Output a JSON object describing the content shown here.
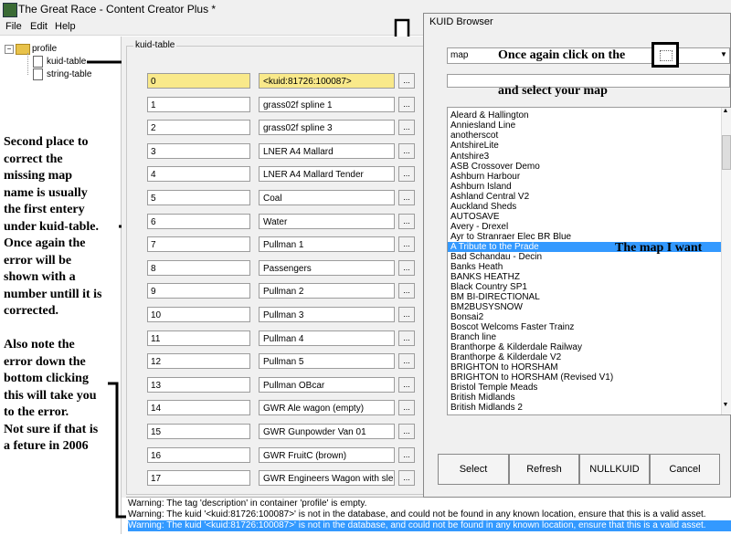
{
  "window": {
    "title": "The Great Race - Content Creator Plus *"
  },
  "menu": [
    "File",
    "Edit",
    "Help"
  ],
  "tree": {
    "root": "profile",
    "children": [
      "kuid-table",
      "string-table"
    ]
  },
  "group_label": "kuid-table",
  "rows": [
    {
      "index": "0",
      "value": "<kuid:81726:100087>"
    },
    {
      "index": "1",
      "value": "grass02f spline 1"
    },
    {
      "index": "2",
      "value": "grass02f spline 3"
    },
    {
      "index": "3",
      "value": "LNER A4 Mallard"
    },
    {
      "index": "4",
      "value": "LNER A4 Mallard Tender"
    },
    {
      "index": "5",
      "value": "Coal"
    },
    {
      "index": "6",
      "value": "Water"
    },
    {
      "index": "7",
      "value": "Pullman 1"
    },
    {
      "index": "8",
      "value": "Passengers"
    },
    {
      "index": "9",
      "value": "Pullman 2"
    },
    {
      "index": "10",
      "value": "Pullman 3"
    },
    {
      "index": "11",
      "value": "Pullman 4"
    },
    {
      "index": "12",
      "value": "Pullman 5"
    },
    {
      "index": "13",
      "value": "Pullman OBcar"
    },
    {
      "index": "14",
      "value": "GWR Ale wagon (empty)"
    },
    {
      "index": "15",
      "value": "GWR Gunpowder Van 01"
    },
    {
      "index": "16",
      "value": "GWR FruitC (brown)"
    },
    {
      "index": "17",
      "value": "GWR Engineers Wagon with sleepe"
    }
  ],
  "dots_label": "...",
  "status_lines": [
    "Warning: The tag 'description' in container 'profile' is empty.",
    "Warning: The kuid '<kuid:81726:100087>' is not in the database, and could not be found in any known location, ensure that this is a valid asset.",
    "Warning: The kuid '<kuid:81726:100087>' is not in the database, and could not be found in any known location, ensure that this is a valid asset."
  ],
  "annotation_left": [
    "Second place to",
    "correct the",
    "missing map",
    "name is usually",
    "the first entery",
    "under kuid-table.",
    "Once again the",
    "error will be",
    "shown with a",
    "number untill it is",
    "corrected.",
    "",
    "Also note the",
    "error down the",
    "bottom clicking",
    "this will take you",
    "to the error.",
    "Not sure if that is",
    "a feture in 2006"
  ],
  "kuid_browser": {
    "title": "KUID Browser",
    "filter_value": "map",
    "annotation_top": "Once again click on the",
    "annotation_select": "and select your map",
    "annotation_map": "The map I want",
    "items": [
      "Aleard & Hallington",
      "Anniesland Line",
      "anotherscot",
      "AntshireLite",
      "Antshire3",
      "ASB Crossover Demo",
      "Ashburn Harbour",
      "Ashburn Island",
      "Ashland Central V2",
      "Auckland Sheds",
      "AUTOSAVE",
      "Avery - Drexel",
      "Ayr to Stranraer Elec BR Blue",
      "A Tribute to the Prade",
      "Bad Schandau - Decin",
      "Banks Heath",
      "BANKS HEATHZ",
      "Black Country SP1",
      "BM BI-DIRECTIONAL",
      "BM2BUSYSNOW",
      "Bonsai2",
      "Boscot Welcoms Faster Trainz",
      "Branch line",
      "Branthorpe & Kilderdale Railway",
      "Branthorpe & Kilderdale V2",
      "BRIGHTON to HORSHAM",
      "BRIGHTON to HORSHAM (Revised V1)",
      "Bristol Temple Meads",
      "British Midlands",
      "British Midlands 2"
    ],
    "selected_index": 13,
    "buttons": [
      "Select",
      "Refresh",
      "NULLKUID",
      "Cancel"
    ]
  }
}
